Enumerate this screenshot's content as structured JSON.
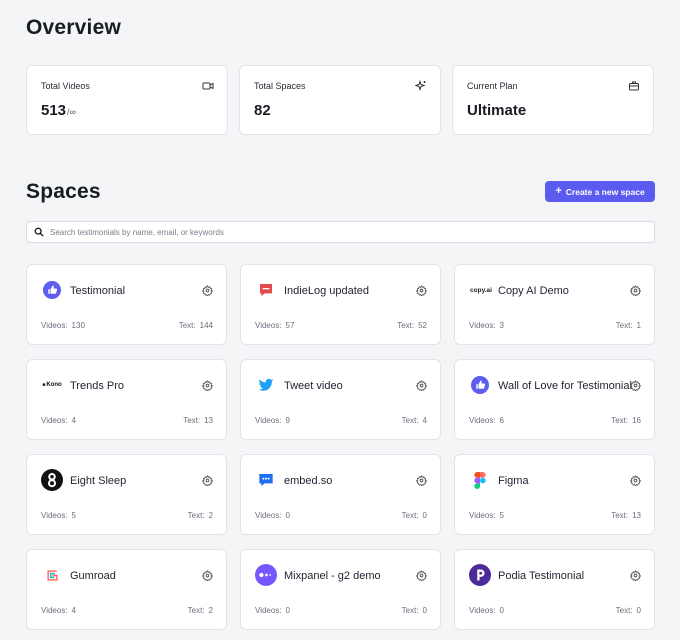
{
  "overview": {
    "title": "Overview",
    "stats": [
      {
        "label": "Total Videos",
        "value": "513",
        "suffix": "/∞",
        "icon": "video-icon"
      },
      {
        "label": "Total Spaces",
        "value": "82",
        "icon": "sparkle-icon"
      },
      {
        "label": "Current Plan",
        "value": "Ultimate",
        "icon": "briefcase-icon"
      }
    ]
  },
  "spaces": {
    "title": "Spaces",
    "create_label": "Create a new space",
    "search_placeholder": "Search testimonials by name, email, or keywords",
    "videos_label": "Videos:",
    "text_label": "Text:",
    "items": [
      {
        "name": "Testimonial",
        "videos": "130",
        "text": "144",
        "logo": "thumbs-up-logo"
      },
      {
        "name": "IndieLog updated",
        "videos": "57",
        "text": "52",
        "logo": "chat-bubble-logo"
      },
      {
        "name": "Copy AI Demo",
        "videos": "3",
        "text": "1",
        "logo": "copy-ai-logo",
        "logo_text": "copy.ai"
      },
      {
        "name": "Trends Pro",
        "videos": "4",
        "text": "13",
        "logo": "kono-logo",
        "logo_text": "Kono"
      },
      {
        "name": "Tweet video",
        "videos": "9",
        "text": "4",
        "logo": "twitter-bird-logo"
      },
      {
        "name": "Wall of Love for Testimonial",
        "videos": "6",
        "text": "16",
        "logo": "thumbs-up-logo"
      },
      {
        "name": "Eight Sleep",
        "videos": "5",
        "text": "2",
        "logo": "eight-sleep-logo"
      },
      {
        "name": "embed.so",
        "videos": "0",
        "text": "0",
        "logo": "embed-chat-logo"
      },
      {
        "name": "Figma",
        "videos": "5",
        "text": "13",
        "logo": "figma-logo"
      },
      {
        "name": "Gumroad",
        "videos": "4",
        "text": "2",
        "logo": "gumroad-logo"
      },
      {
        "name": "Mixpanel - g2 demo",
        "videos": "0",
        "text": "0",
        "logo": "mixpanel-logo"
      },
      {
        "name": "Podia Testimonial",
        "videos": "0",
        "text": "0",
        "logo": "podia-logo"
      }
    ]
  },
  "colors": {
    "accent": "#5b5bf0",
    "background": "#f4f5f7"
  }
}
